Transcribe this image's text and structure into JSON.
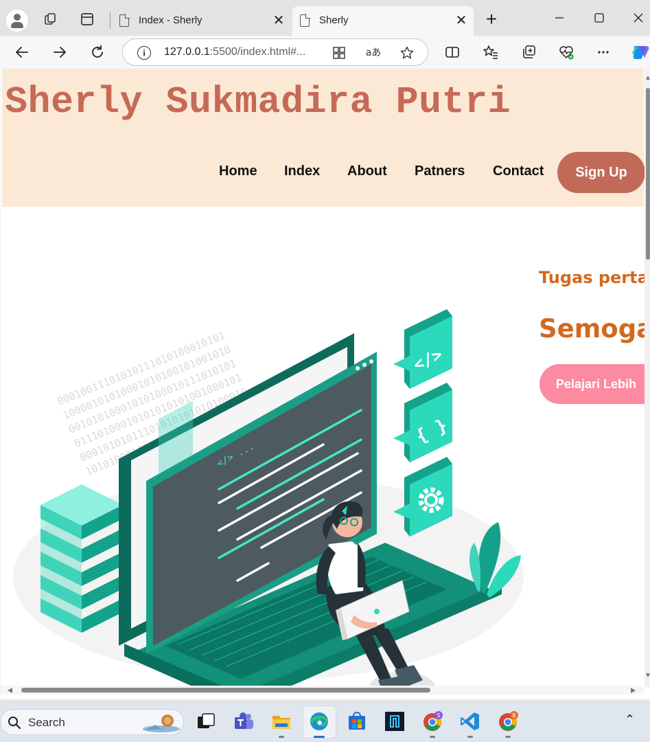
{
  "browser": {
    "tabs": [
      {
        "title": "Index - Sherly",
        "active": false
      },
      {
        "title": "Sherly",
        "active": true
      }
    ],
    "close_glyph": "✕",
    "new_tab_glyph": "+",
    "address": {
      "host": "127.0.0.1",
      "rest": ":5500/index.html#..."
    },
    "read_aloud_glyph": "aあ"
  },
  "page": {
    "logo": "Sherly Sukmadira Putri",
    "nav": [
      "Home",
      "Index",
      "About",
      "Patners",
      "Contact"
    ],
    "signup": "Sign Up",
    "hero": {
      "subtitle": "Tugas pertar",
      "title": "Semoga",
      "cta": "Pelajari Lebih"
    },
    "image_glyphs": {
      "code_tag": "</>",
      "braces": "{ }",
      "editor_tag": "</> ...",
      "binary": [
        "00010011101010111010100010101",
        "10000101010001010100101001010",
        "00101010001010100010111010101",
        "01110100010101010101001000101",
        "00010101011101010101010100010",
        "10101000101010001001010101010"
      ]
    },
    "colors": {
      "header_bg": "#fbe9d6",
      "logo": "#c56a56",
      "signup_bg": "#c26a58",
      "accent": "#d2691e",
      "cta_bg": "#fc8aa1",
      "teal": "#13a28a"
    }
  },
  "taskbar": {
    "search_label": "Search",
    "apps": [
      "task-view",
      "teams",
      "file-explorer",
      "edge",
      "microsoft-store",
      "app-icon",
      "chrome-profile-s",
      "vscode",
      "chrome-profile-b"
    ],
    "badge_s": "S",
    "badge_b": "B",
    "tray_glyph": "⌃"
  }
}
